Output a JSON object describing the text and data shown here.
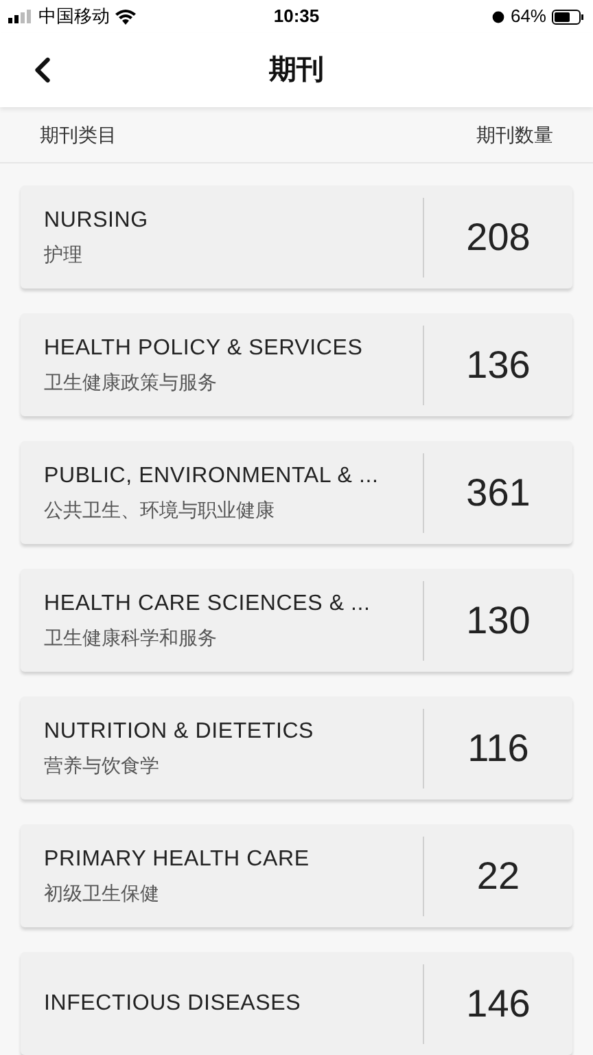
{
  "status_bar": {
    "carrier": "中国移动",
    "time": "10:35",
    "battery": "64%"
  },
  "header": {
    "title": "期刊"
  },
  "columns": [
    "期刊类目",
    "期刊数量"
  ],
  "categories": [
    {
      "name": "NURSING",
      "name_zh": "护理",
      "count": "208"
    },
    {
      "name": "HEALTH POLICY & SERVICES",
      "name_zh": "卫生健康政策与服务",
      "count": "136"
    },
    {
      "name": "PUBLIC, ENVIRONMENTAL & ...",
      "name_zh": "公共卫生、环境与职业健康",
      "count": "361"
    },
    {
      "name": "HEALTH CARE SCIENCES & ...",
      "name_zh": "卫生健康科学和服务",
      "count": "130"
    },
    {
      "name": "NUTRITION & DIETETICS",
      "name_zh": "营养与饮食学",
      "count": "116"
    },
    {
      "name": "PRIMARY HEALTH CARE",
      "name_zh": "初级卫生保健",
      "count": "22"
    },
    {
      "name": "INFECTIOUS DISEASES",
      "count": "146"
    }
  ]
}
